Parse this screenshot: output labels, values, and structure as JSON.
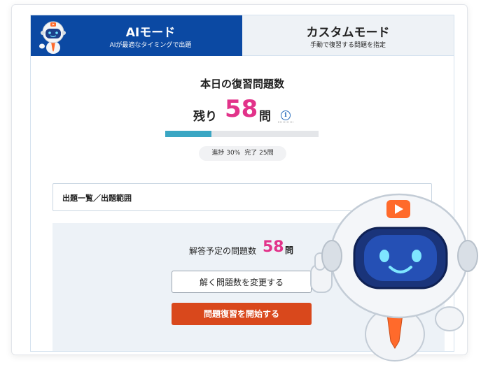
{
  "tabs": {
    "ai": {
      "title": "AIモード",
      "subtitle": "AIが最適なタイミングで出題"
    },
    "custom": {
      "title": "カスタムモード",
      "subtitle": "手動で復習する問題を指定"
    }
  },
  "today": {
    "title": "本日の復習問題数",
    "remaining_prefix": "残り",
    "remaining_count": "58",
    "unit": "問",
    "info_icon": "info-icon"
  },
  "progress": {
    "fraction": 0.3,
    "progress_text": "進捗 30%",
    "completed_text": "完了 25問"
  },
  "question_list": {
    "label": "出題一覧／出題範囲"
  },
  "plan": {
    "label": "解答予定の問題数",
    "count": "58",
    "unit": "問"
  },
  "buttons": {
    "change_label": "解く問題数を変更する",
    "start_label": "問題復習を開始する"
  },
  "colors": {
    "primary_blue": "#0b49a3",
    "accent_pink": "#e2338a",
    "progress_teal": "#3aa6c3",
    "start_orange": "#d9481c"
  }
}
